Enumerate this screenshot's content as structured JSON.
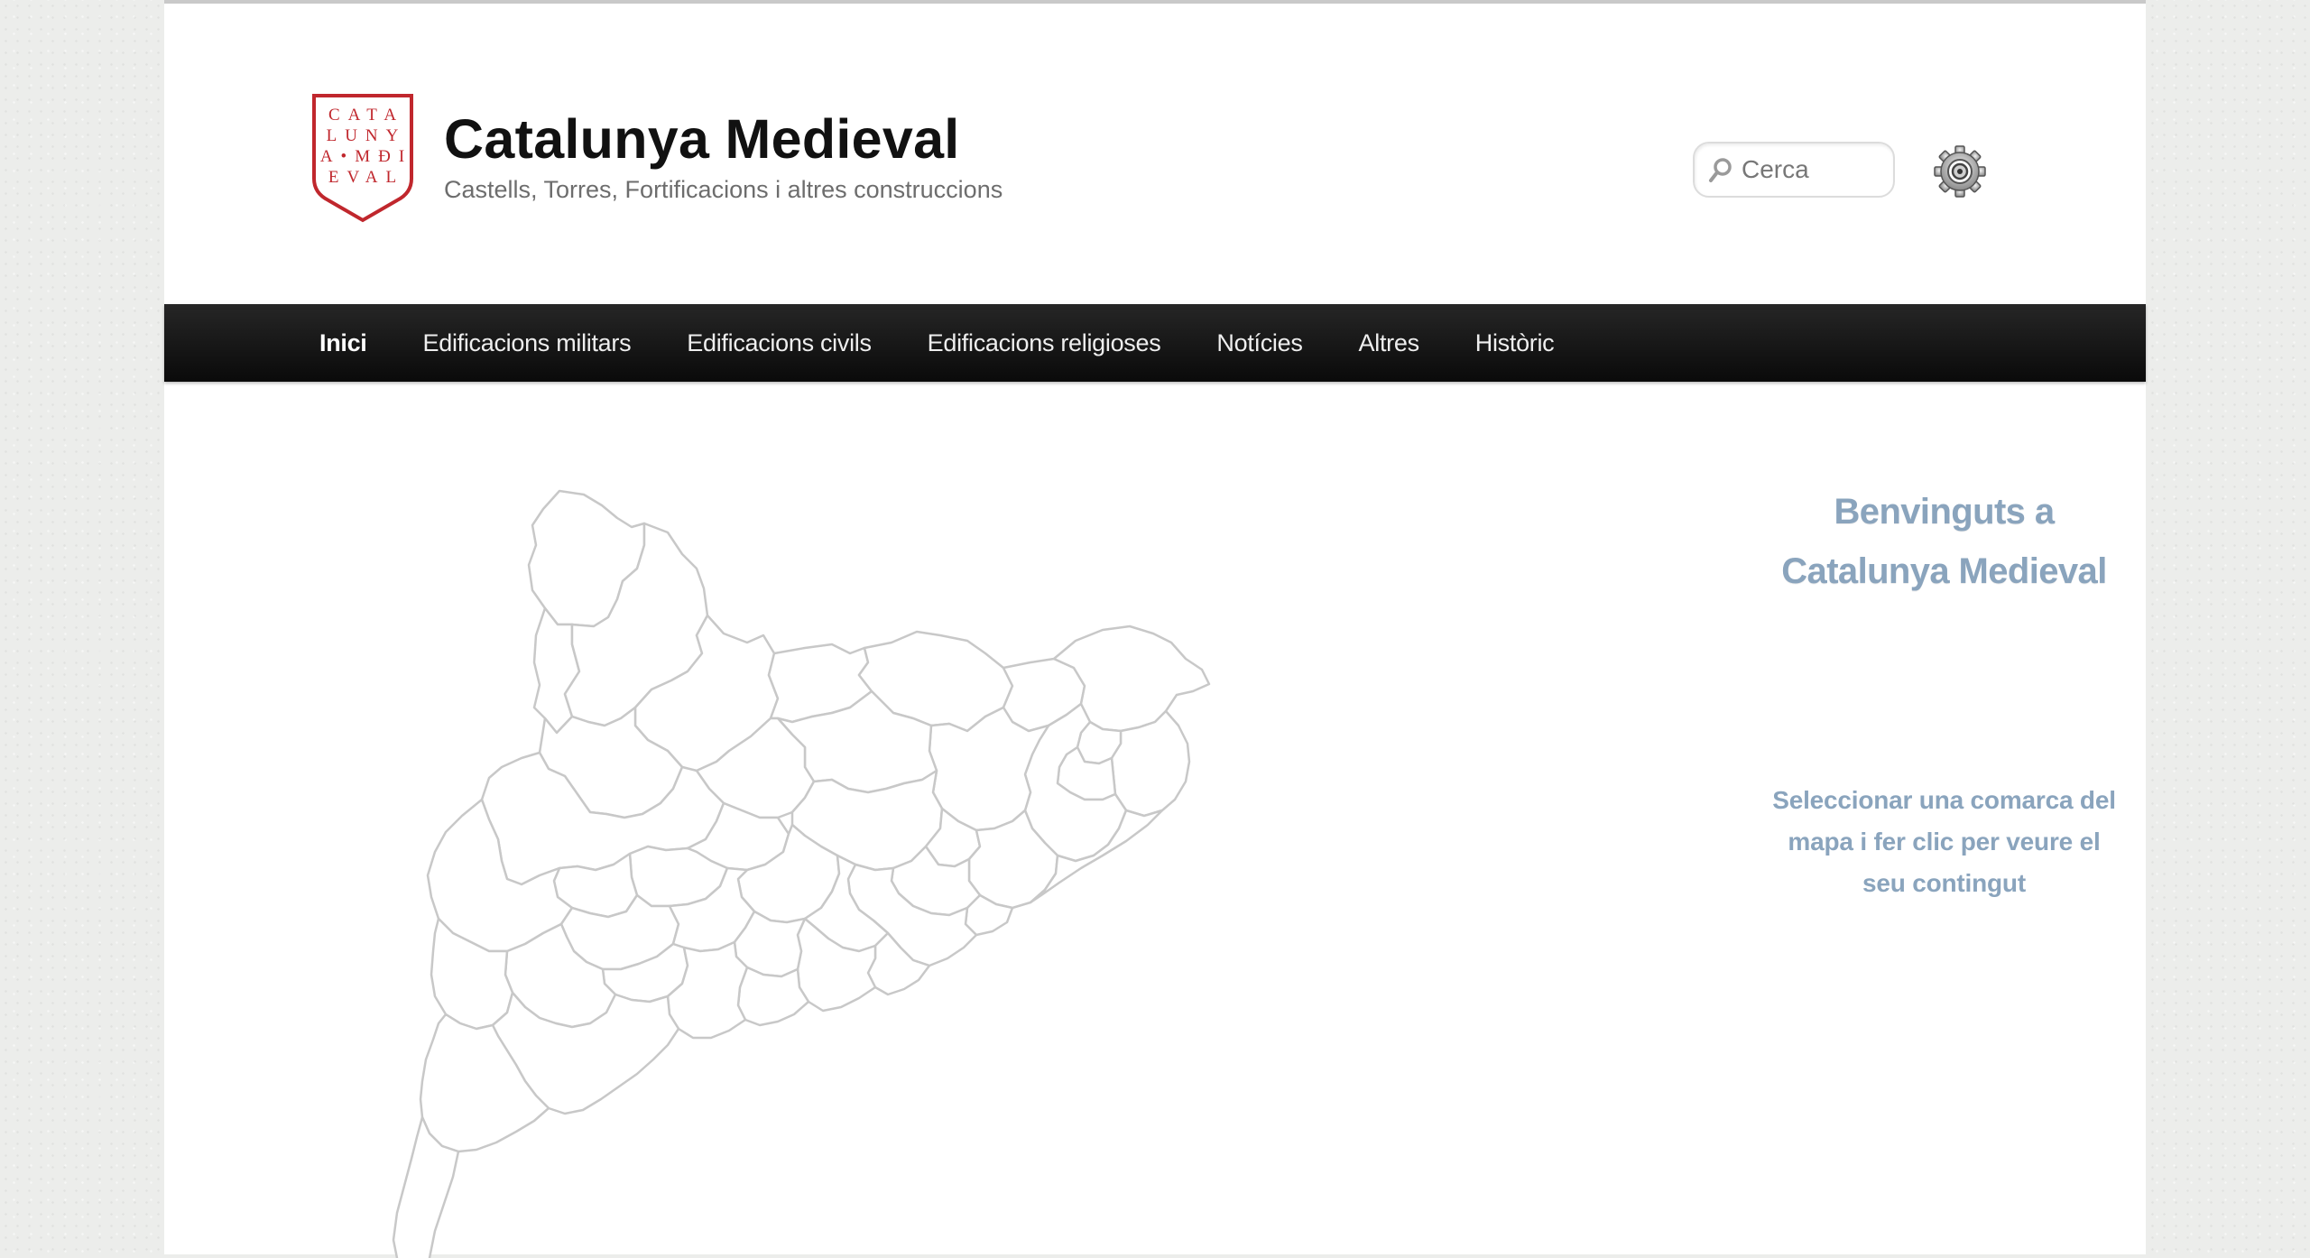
{
  "header": {
    "logo_letters": [
      "CATA",
      "LUNY",
      "A•MĐI",
      "EVAL"
    ],
    "site_title": "Catalunya Medieval",
    "tagline": "Castells, Torres, Fortificacions i altres construccions",
    "search": {
      "placeholder": "Cerca",
      "value": ""
    },
    "gear_icon": "gear-icon"
  },
  "nav": {
    "items": [
      {
        "label": "Inici",
        "active": true
      },
      {
        "label": "Edificacions militars"
      },
      {
        "label": "Edificacions civils"
      },
      {
        "label": "Edificacions religioses"
      },
      {
        "label": "Notícies"
      },
      {
        "label": "Altres"
      },
      {
        "label": "Històric"
      }
    ]
  },
  "main": {
    "welcome_lines": [
      "Benvinguts a",
      "Catalunya Medieval"
    ],
    "instruction_lines": [
      "Seleccionar una comarca del",
      "mapa i fer clic per veure el",
      "seu contingut"
    ]
  },
  "colors": {
    "accent_text": "#8aa4bd",
    "logo_red": "#c0272d",
    "nav_bg": "#111111"
  }
}
